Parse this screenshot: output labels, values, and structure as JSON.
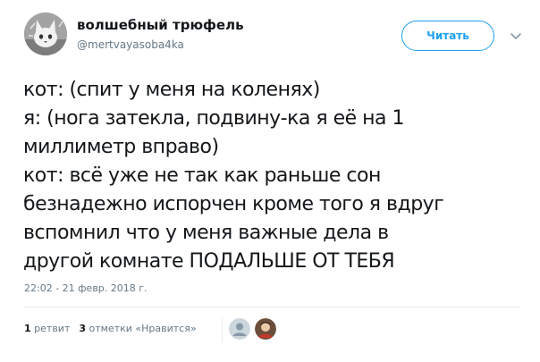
{
  "author": {
    "display_name": "волшебный трюфель",
    "username": "@mertvayasoba4ka",
    "avatar_icon": "cat-avatar-icon"
  },
  "follow_button": {
    "label": "Читать"
  },
  "menu": {
    "icon": "chevron-down-icon"
  },
  "tweet": {
    "lines": [
      "кот: (спит у меня на коленях)",
      "я: (нога затекла, подвину-ка я её на 1",
      "миллиметр вправо)",
      "кот: всё уже не так как раньше сон",
      "безнадежно испорчен кроме того я вдруг",
      "вспомнил что  у меня важные дела в",
      "другой комнате ПОДАЛЬШЕ ОТ ТЕБЯ"
    ],
    "timestamp": "22:02 - 21 февр. 2018 г."
  },
  "stats": {
    "retweets_count": "1",
    "retweets_label": "ретвит",
    "likes_count": "3",
    "likes_label": "отметки «Нравится»"
  },
  "likers": [
    {
      "icon": "default-user-avatar-icon"
    },
    {
      "icon": "user-avatar-icon"
    }
  ],
  "colors": {
    "accent": "#1da1f2",
    "secondary_text": "#657786",
    "primary_text": "#14171a",
    "divider": "#e6ecf0"
  }
}
